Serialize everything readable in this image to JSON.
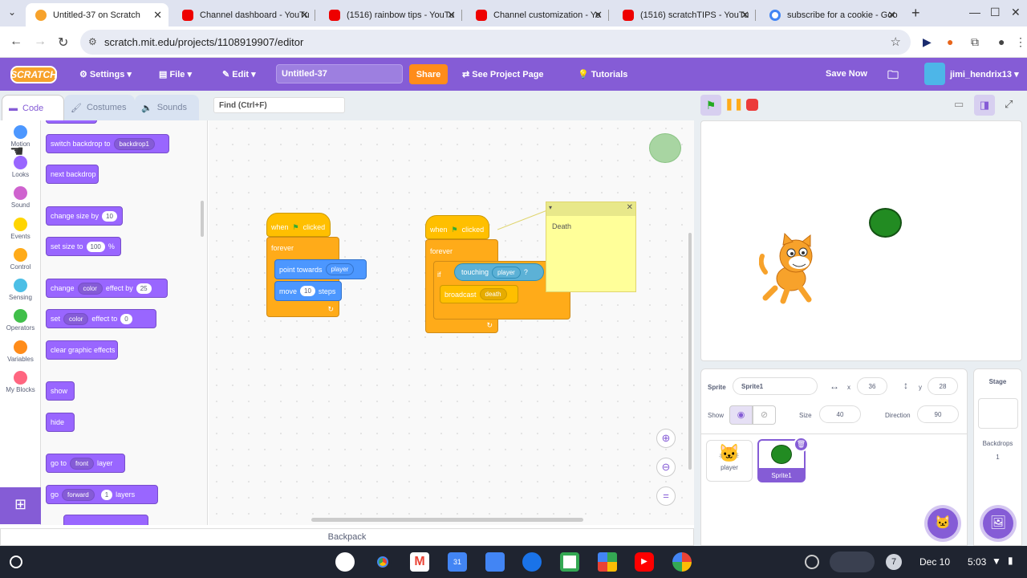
{
  "browser": {
    "tabs": [
      {
        "title": "Untitled-37 on Scratch",
        "icon": "scratch-icon",
        "active": true
      },
      {
        "title": "Channel dashboard - YouTu",
        "icon": "youtube-icon"
      },
      {
        "title": "(1516) rainbow tips - YouTu",
        "icon": "youtube-icon"
      },
      {
        "title": "Channel customization - Yo",
        "icon": "youtube-icon"
      },
      {
        "title": "(1516) scratchTIPS - YouTu",
        "icon": "youtube-icon"
      },
      {
        "title": "subscribe for a cookie - Goo",
        "icon": "google-icon"
      }
    ],
    "url": "scratch.mit.edu/projects/1108919907/editor"
  },
  "menu": {
    "logo": "SCRATCH",
    "settings": "Settings",
    "file": "File",
    "edit": "Edit",
    "project_title": "Untitled-37",
    "share": "Share",
    "see_project": "See Project Page",
    "tutorials": "Tutorials",
    "save_now": "Save Now",
    "username": "jimi_hendrix13"
  },
  "editor_tabs": {
    "code": "Code",
    "costumes": "Costumes",
    "sounds": "Sounds"
  },
  "find_placeholder": "Find (Ctrl+F)",
  "categories": [
    {
      "label": "Motion",
      "color": "#4c97ff"
    },
    {
      "label": "Looks",
      "color": "#9966ff"
    },
    {
      "label": "Sound",
      "color": "#cf63cf"
    },
    {
      "label": "Events",
      "color": "#ffd500"
    },
    {
      "label": "Control",
      "color": "#ffab19"
    },
    {
      "label": "Sensing",
      "color": "#4cbfe6"
    },
    {
      "label": "Operators",
      "color": "#40bf4a"
    },
    {
      "label": "Variables",
      "color": "#ff8c1a"
    },
    {
      "label": "My Blocks",
      "color": "#ff6680"
    }
  ],
  "palette": {
    "switch_backdrop": "switch backdrop to",
    "backdrop1": "backdrop1",
    "next_backdrop": "next backdrop",
    "change_size": "change size by",
    "change_size_val": "10",
    "set_size": "set size to",
    "set_size_val": "100",
    "percent": "%",
    "change_effect": "change",
    "color1": "color",
    "effect_by": "effect by",
    "effect_by_val": "25",
    "set_effect": "set",
    "color2": "color",
    "effect_to": "effect to",
    "effect_to_val": "0",
    "clear_effects": "clear graphic effects",
    "show": "show",
    "hide": "hide",
    "go_to": "go to",
    "front": "front",
    "layer": "layer",
    "go": "go",
    "forward": "forward",
    "layers_val": "1",
    "layers": "layers"
  },
  "script1": {
    "when": "when",
    "clicked": "clicked",
    "forever": "forever",
    "point_towards": "point towards",
    "player": "player",
    "move": "move",
    "move_val": "10",
    "steps": "steps"
  },
  "script2": {
    "when": "when",
    "clicked": "clicked",
    "forever": "forever",
    "if": "if",
    "touching": "touching",
    "player": "player",
    "q": "?",
    "broadcast": "broadcast",
    "death": "death"
  },
  "comment": "Death",
  "backpack": "Backpack",
  "sprite_info": {
    "sprite_label": "Sprite",
    "sprite_name": "Sprite1",
    "x_label": "x",
    "x": "36",
    "y_label": "y",
    "y": "28",
    "show_label": "Show",
    "size_label": "Size",
    "size": "40",
    "direction_label": "Direction",
    "direction": "90"
  },
  "sprites": [
    {
      "name": "player"
    },
    {
      "name": "Sprite1",
      "selected": true
    }
  ],
  "stage_panel": {
    "title": "Stage",
    "backdrops_label": "Backdrops",
    "backdrops_count": "1"
  },
  "shelf": {
    "date": "Dec 10",
    "time": "5:03",
    "badge": "7"
  }
}
